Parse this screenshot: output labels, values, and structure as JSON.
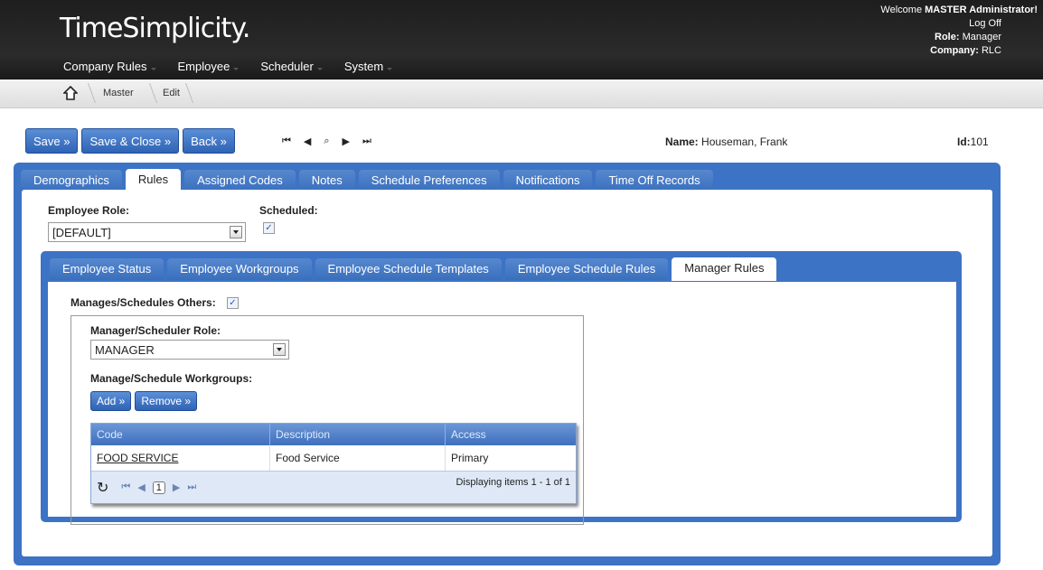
{
  "app": {
    "logo": "TimeSimplicity",
    "trademark": "."
  },
  "topnav": {
    "items": [
      "Company Rules",
      "Employee",
      "Scheduler",
      "System"
    ]
  },
  "user": {
    "welcome_prefix": "Welcome ",
    "name": "MASTER Administrator!",
    "logoff": "Log Off",
    "role_label": "Role:",
    "role": "Manager",
    "company_label": "Company:",
    "company": "RLC"
  },
  "breadcrumb": {
    "items": [
      "Master",
      "Edit"
    ]
  },
  "toolbar": {
    "save": "Save »",
    "save_close": "Save & Close »",
    "back": "Back »"
  },
  "record": {
    "name_label": "Name:",
    "name": "Houseman, Frank",
    "id_label": "Id:",
    "id": "101"
  },
  "main_tabs": [
    "Demographics",
    "Rules",
    "Assigned Codes",
    "Notes",
    "Schedule Preferences",
    "Notifications",
    "Time Off Records"
  ],
  "main_tabs_active": "Rules",
  "rules": {
    "employee_role_label": "Employee Role:",
    "employee_role_value": "[DEFAULT]",
    "scheduled_label": "Scheduled:",
    "scheduled_checked": true
  },
  "sub_tabs": [
    "Employee Status",
    "Employee Workgroups",
    "Employee Schedule Templates",
    "Employee Schedule Rules",
    "Manager Rules"
  ],
  "sub_tabs_active": "Manager Rules",
  "manager": {
    "manages_label": "Manages/Schedules Others:",
    "manages_checked": true,
    "role_label": "Manager/Scheduler Role:",
    "role_value": "MANAGER",
    "workgroups_label": "Manage/Schedule Workgroups:",
    "add": "Add »",
    "remove": "Remove »"
  },
  "grid": {
    "columns": [
      "Code",
      "Description",
      "Access"
    ],
    "rows": [
      {
        "code": "FOOD SERVICE",
        "description": "Food Service",
        "access": "Primary"
      }
    ],
    "page": "1",
    "status": "Displaying items 1 - 1 of 1"
  }
}
